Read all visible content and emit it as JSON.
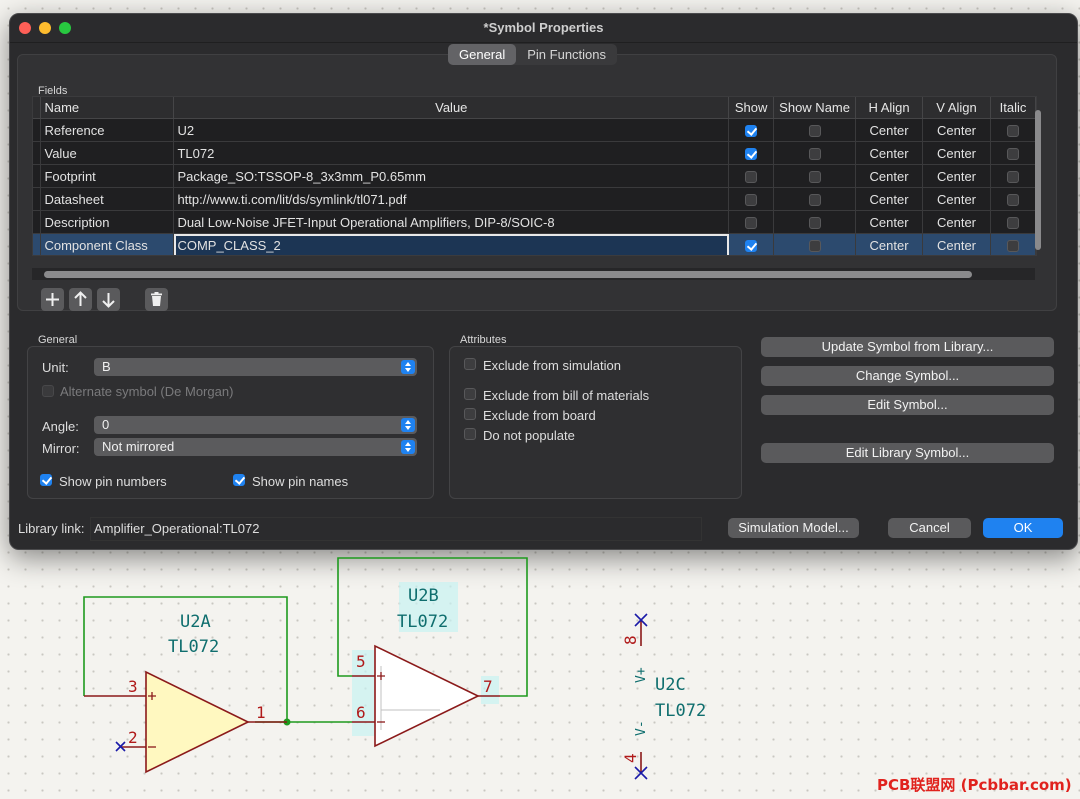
{
  "window": {
    "title": "*Symbol Properties"
  },
  "tabs": [
    {
      "label": "General",
      "active": true
    },
    {
      "label": "Pin Functions",
      "active": false
    }
  ],
  "fields": {
    "section_label": "Fields",
    "columns": [
      "Name",
      "Value",
      "Show",
      "Show Name",
      "H Align",
      "V Align",
      "Italic"
    ],
    "rows": [
      {
        "name": "Reference",
        "value": "U2",
        "show": true,
        "show_name": false,
        "h_align": "Center",
        "v_align": "Center",
        "italic": false
      },
      {
        "name": "Value",
        "value": "TL072",
        "show": true,
        "show_name": false,
        "h_align": "Center",
        "v_align": "Center",
        "italic": false
      },
      {
        "name": "Footprint",
        "value": "Package_SO:TSSOP-8_3x3mm_P0.65mm",
        "show": false,
        "show_name": false,
        "h_align": "Center",
        "v_align": "Center",
        "italic": false
      },
      {
        "name": "Datasheet",
        "value": "http://www.ti.com/lit/ds/symlink/tl071.pdf",
        "show": false,
        "show_name": false,
        "h_align": "Center",
        "v_align": "Center",
        "italic": false
      },
      {
        "name": "Description",
        "value": "Dual Low-Noise JFET-Input Operational Amplifiers, DIP-8/SOIC-8",
        "show": false,
        "show_name": false,
        "h_align": "Center",
        "v_align": "Center",
        "italic": false
      },
      {
        "name": "Component Class",
        "value": "COMP_CLASS_2",
        "show": true,
        "show_name": false,
        "h_align": "Center",
        "v_align": "Center",
        "italic": false,
        "selected": true
      }
    ],
    "toolbar_icons": [
      "add-icon",
      "move-up-icon",
      "move-down-icon",
      "trash-icon"
    ]
  },
  "general": {
    "section_label": "General",
    "unit_label": "Unit:",
    "unit_value": "B",
    "alternate_label": "Alternate symbol (De Morgan)",
    "angle_label": "Angle:",
    "angle_value": "0",
    "mirror_label": "Mirror:",
    "mirror_value": "Not mirrored",
    "show_pin_numbers_label": "Show pin numbers",
    "show_pin_numbers": true,
    "show_pin_names_label": "Show pin names",
    "show_pin_names": true
  },
  "attributes": {
    "section_label": "Attributes",
    "items": [
      {
        "label": "Exclude from simulation",
        "checked": false
      },
      {
        "label": "Exclude from bill of materials",
        "checked": false
      },
      {
        "label": "Exclude from board",
        "checked": false
      },
      {
        "label": "Do not populate",
        "checked": false
      }
    ]
  },
  "actions": {
    "update_symbol": "Update Symbol from Library...",
    "change_symbol": "Change Symbol...",
    "edit_symbol": "Edit Symbol...",
    "edit_library_symbol": "Edit Library Symbol..."
  },
  "footer": {
    "library_link_label": "Library link:",
    "library_link_value": "Amplifier_Operational:TL072",
    "simulation_model": "Simulation Model...",
    "cancel": "Cancel",
    "ok": "OK"
  },
  "schematic": {
    "u2a": {
      "ref": "U2A",
      "value": "TL072",
      "pins": [
        "3",
        "2",
        "1"
      ]
    },
    "u2b": {
      "ref": "U2B",
      "value": "TL072",
      "pins": [
        "5",
        "6",
        "7"
      ]
    },
    "u2c": {
      "ref": "U2C",
      "value": "TL072",
      "pins": [
        "8",
        "4"
      ],
      "pin_names": [
        "V+",
        "V-"
      ]
    },
    "colors": {
      "wire": "#1e9a1e",
      "body": "#8b1a1a",
      "fill": "#fff8c0",
      "ref": "#0f6e6e",
      "pin": "#b01a1a",
      "no_connect": "#1a1aa8"
    }
  },
  "watermark": "PCB联盟网 (Pcbbar.com)"
}
